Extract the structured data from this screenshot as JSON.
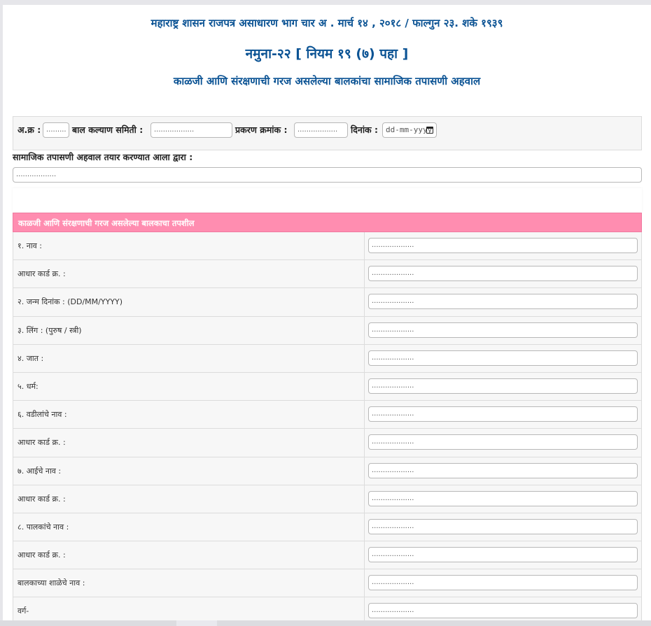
{
  "header": {
    "gazette_line": "महाराष्ट्र शासन राजपत्र असाधारण भाग चार अ . मार्च १४ , २०१८ / फाल्गुन २३. शके १९३९",
    "form_title": "नमुना-२२ [ नियम १९ (७) पहा ]",
    "report_title": "काळजी आणि संरक्षणाची गरज असलेल्या बालकांचा सामाजिक तपासणी अहवाल"
  },
  "meta": {
    "serial_label": "अ.क्र :",
    "serial_value": ".........",
    "committee_label": "बाल कल्याण समिती :",
    "committee_value": "..................",
    "case_label": "प्रकरण क्रमांक :",
    "case_value": "..................",
    "date_label": "दिनांक :",
    "date_value": "dd-mm-yyyy"
  },
  "prepared_by": {
    "label": "सामाजिक तपासणी अहवाल तयार करण्यात आला द्वारा :",
    "value": ".................."
  },
  "section": {
    "title": "काळजी आणि संरक्षणाची गरज असलेल्या बालकाचा तपशील"
  },
  "rows": [
    {
      "label": "१. नाव :",
      "value": "..................."
    },
    {
      "label": "आधार कार्ड क्र. :",
      "value": "..................."
    },
    {
      "label": "२. जन्म दिनांक : (DD/MM/YYYY)",
      "value": "..................."
    },
    {
      "label": "३. लिंग : (पुरुष / स्त्री)",
      "value": "..................."
    },
    {
      "label": "४. जात :",
      "value": "..................."
    },
    {
      "label": "५. धर्म:",
      "value": "..................."
    },
    {
      "label": "६. वडीलांचे नाव :",
      "value": "..................."
    },
    {
      "label": "आधार कार्ड क्र. :",
      "value": "..................."
    },
    {
      "label": "७. आईचे नाव :",
      "value": "..................."
    },
    {
      "label": "आधार कार्ड क्र. :",
      "value": "..................."
    },
    {
      "label": "८. पालकांचे नाव :",
      "value": "..................."
    },
    {
      "label": "आधार कार्ड क्र. :",
      "value": "..................."
    },
    {
      "label": "बालकाच्या शाळेचे नाव :",
      "value": "..................."
    },
    {
      "label": "वर्ग-",
      "value": "..................."
    }
  ],
  "colors": {
    "title_blue": "#0b5394",
    "section_pink": "#ff8db0",
    "row_bg": "#f7f7f7"
  }
}
